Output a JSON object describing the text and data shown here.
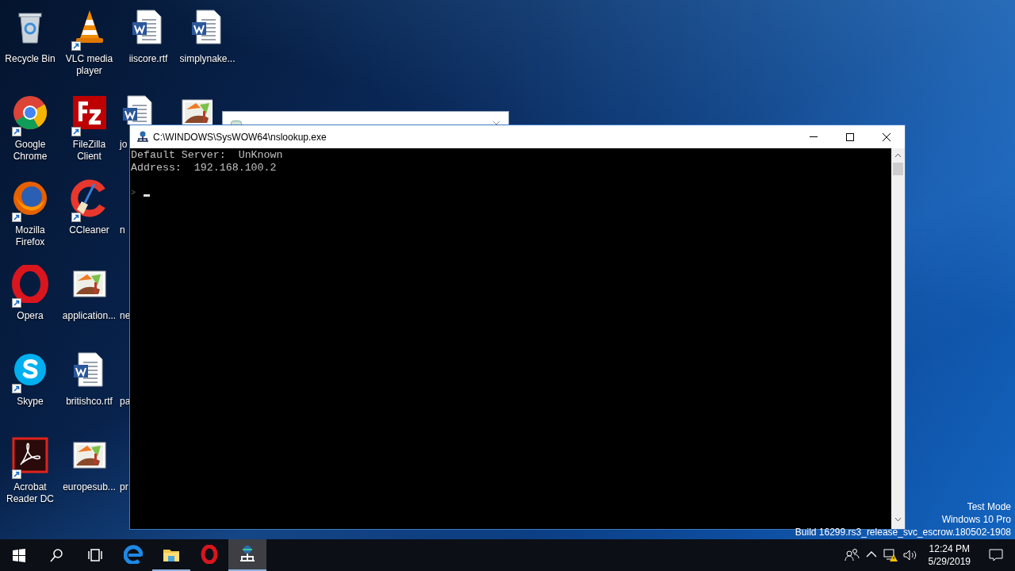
{
  "desktop": {
    "columns": [
      [
        {
          "label": "Recycle Bin",
          "kind": "recycle",
          "shortcut": false
        },
        {
          "label": "Google Chrome",
          "kind": "chrome",
          "shortcut": true
        },
        {
          "label": "Mozilla Firefox",
          "kind": "firefox",
          "shortcut": true
        },
        {
          "label": "Opera",
          "kind": "opera",
          "shortcut": true
        },
        {
          "label": "Skype",
          "kind": "skype",
          "shortcut": true
        },
        {
          "label": "Acrobat Reader DC",
          "kind": "acrobat",
          "shortcut": true
        }
      ],
      [
        {
          "label": "VLC media player",
          "kind": "vlc",
          "shortcut": true
        },
        {
          "label": "FileZilla Client",
          "kind": "filezilla",
          "shortcut": true
        },
        {
          "label": "CCleaner",
          "kind": "ccleaner",
          "shortcut": true
        },
        {
          "label": "application...",
          "kind": "image",
          "shortcut": false
        },
        {
          "label": "britishco.rtf",
          "kind": "word",
          "shortcut": false
        },
        {
          "label": "europesub...",
          "kind": "image",
          "shortcut": false
        }
      ],
      [
        {
          "label": "iiscore.rtf",
          "kind": "word",
          "shortcut": false
        },
        {
          "label": "jo",
          "kind": "word",
          "shortcut": false,
          "covered": true
        },
        {
          "label": "n",
          "covered": true
        },
        {
          "label": "ne",
          "covered": true
        },
        {
          "label": "pa",
          "covered": true
        },
        {
          "label": "pr",
          "covered": true
        }
      ],
      [
        {
          "label": "simplynake...",
          "kind": "word",
          "shortcut": false
        },
        {
          "kind": "image",
          "shortcut": false,
          "covered": true
        }
      ]
    ]
  },
  "background_window": {
    "kind": "properties"
  },
  "console": {
    "title": "C:\\WINDOWS\\SysWOW64\\nslookup.exe",
    "lines": [
      "Default Server:  UnKnown",
      "Address:  192.168.100.2"
    ],
    "prompt": ">"
  },
  "os_watermark": [
    "Test Mode",
    "Windows 10 Pro",
    "Build 16299.rs3_release_svc_escrow.180502-1908"
  ],
  "taskbar": {
    "buttons": [
      {
        "kind": "start"
      },
      {
        "kind": "search"
      },
      {
        "kind": "task_view"
      }
    ],
    "apps": [
      {
        "kind": "edge",
        "running": false,
        "active": false
      },
      {
        "kind": "explorer",
        "running": true,
        "active": false
      },
      {
        "kind": "opera",
        "running": false,
        "active": false
      },
      {
        "kind": "nslookup",
        "running": true,
        "active": true
      }
    ],
    "tray": [
      {
        "kind": "people"
      },
      {
        "kind": "chevron"
      },
      {
        "kind": "network"
      },
      {
        "kind": "volume"
      }
    ],
    "time": "12:24 PM",
    "date": "5/29/2019"
  }
}
